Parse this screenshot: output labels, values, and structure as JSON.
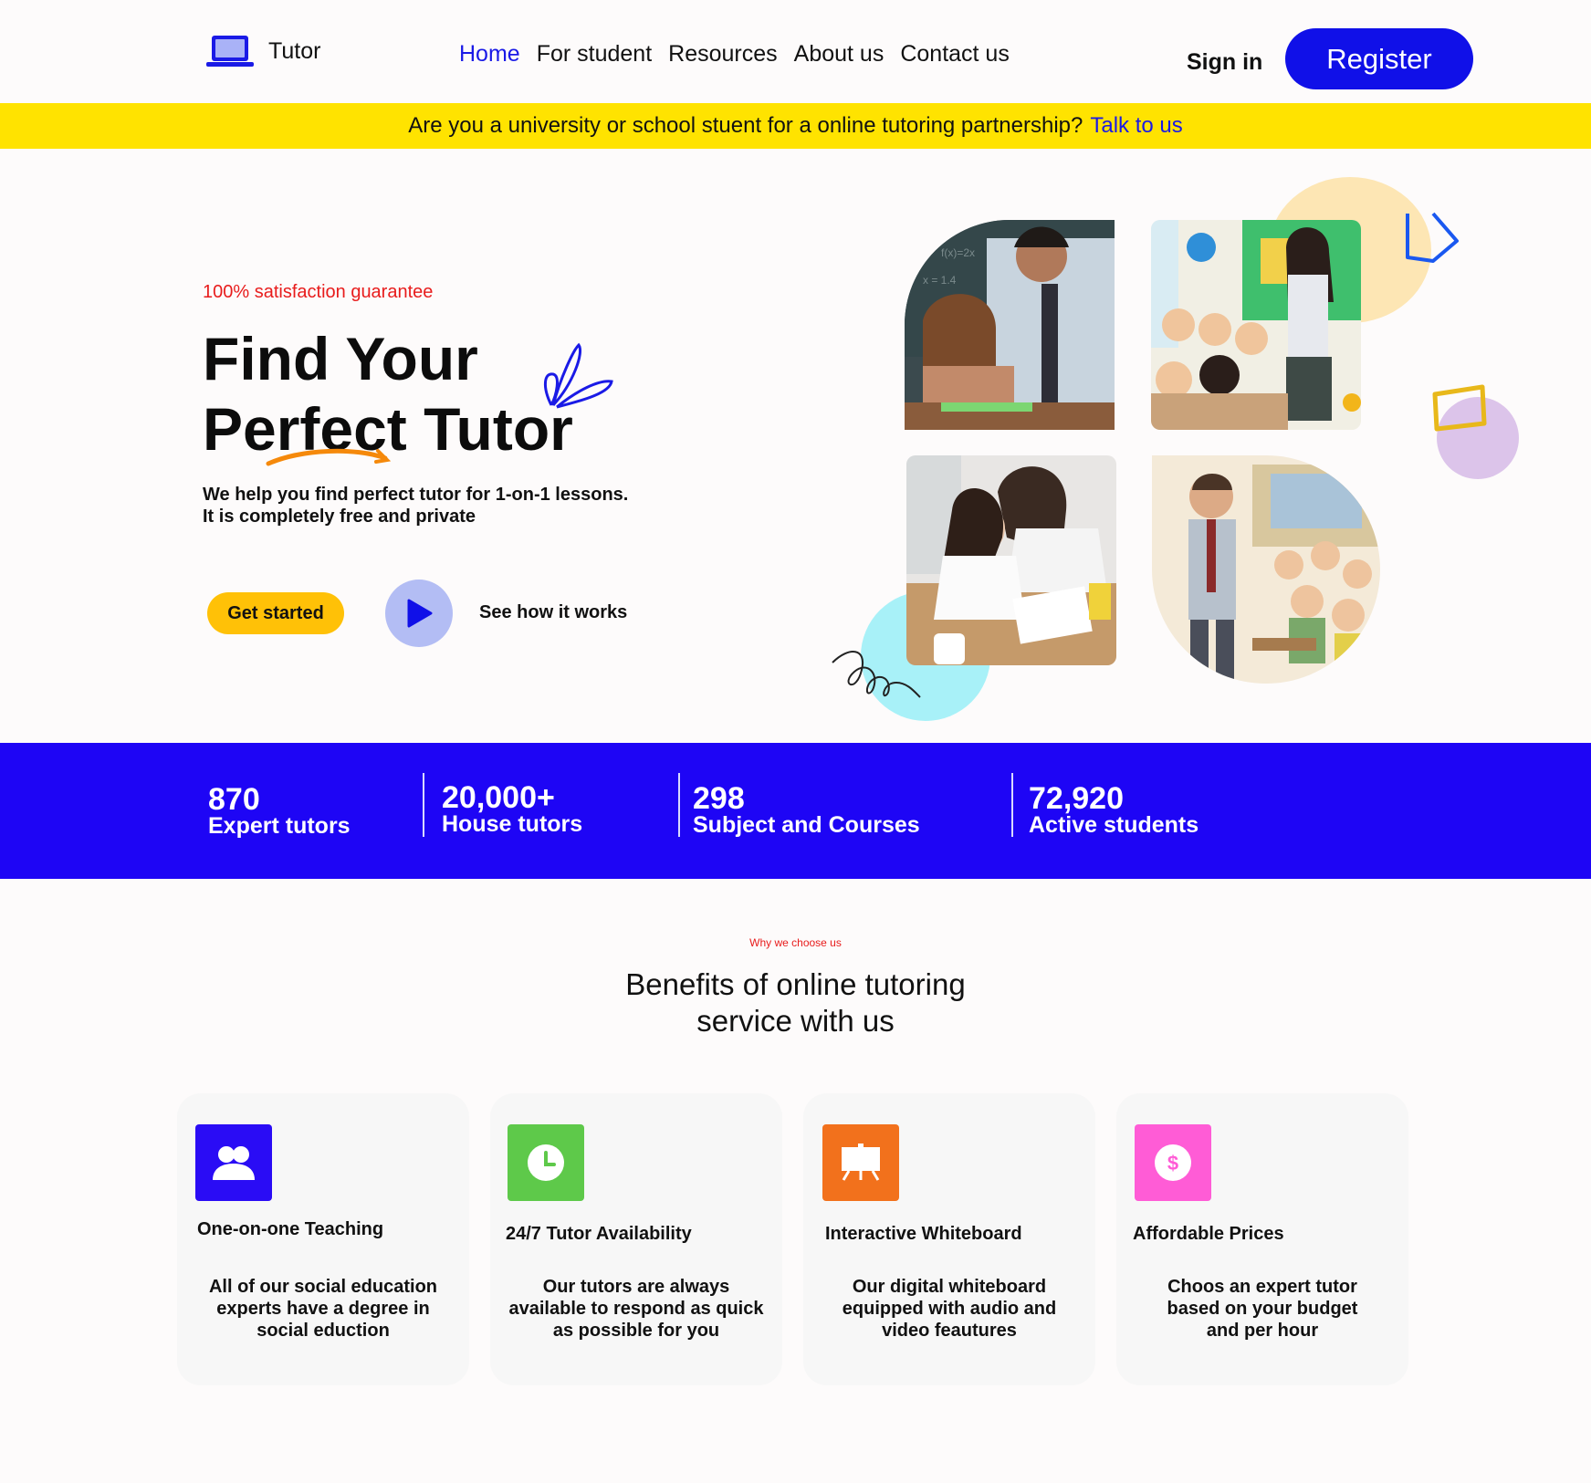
{
  "header": {
    "logo_text": "Tutor",
    "nav": [
      "Home",
      "For student",
      "Resources",
      "About us",
      "Contact us"
    ],
    "sign_in": "Sign in",
    "register": "Register"
  },
  "banner": {
    "text": "Are you a university or school stuent for a online tutoring partnership?",
    "link": "Talk to us"
  },
  "hero": {
    "tagline": "100% satisfaction guarantee",
    "title_line1": "Find Your",
    "title_line2": "Perfect Tutor",
    "subtitle_line1": "We help you find perfect tutor for 1-on-1 lessons.",
    "subtitle_line2": "It is completely free and private",
    "get_started": "Get started",
    "see_how": "See how it works"
  },
  "stats": [
    {
      "num": "870",
      "label": "Expert tutors"
    },
    {
      "num": "20,000+",
      "label": "House tutors"
    },
    {
      "num": "298",
      "label": "Subject and Courses"
    },
    {
      "num": "72,920",
      "label": "Active students"
    }
  ],
  "benefits": {
    "eyebrow": "Why we choose  us",
    "title_line1": "Benefits of online tutoring",
    "title_line2": "service  with us",
    "cards": [
      {
        "title": "One-on-one Teaching",
        "desc": "All of our social education experts have a degree in social eduction",
        "icon": "people-icon",
        "color": "#2a0cf5"
      },
      {
        "title": "24/7 Tutor Availability",
        "desc": "Our tutors are always available to respond as quick as possible for you",
        "icon": "clock-icon",
        "color": "#5ec94a"
      },
      {
        "title": "Interactive Whiteboard",
        "desc": "Our digital whiteboard equipped with audio and video feautures",
        "icon": "whiteboard-icon",
        "color": "#f2711c"
      },
      {
        "title": "Affordable Prices",
        "desc": "Choos an expert tutor based on your budget and per hour",
        "icon": "dollar-icon",
        "color": "#ff5cd6"
      }
    ]
  },
  "colors": {
    "accent_blue": "#1010e8",
    "banner_yellow": "#ffe300",
    "stats_blue": "#1e05f5",
    "tagline_red": "#e81c1c",
    "cta_yellow": "#ffc107"
  }
}
